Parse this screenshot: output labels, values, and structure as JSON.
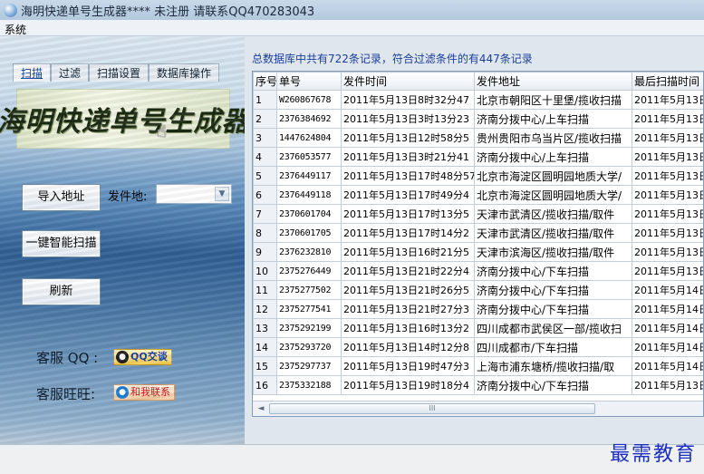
{
  "window": {
    "title": "海明快递单号生成器****  未注册 请联系QQ470283043"
  },
  "menu": {
    "items": [
      "系统"
    ]
  },
  "left": {
    "tabs": [
      "扫描",
      "过滤",
      "扫描设置",
      "数据库操作"
    ],
    "banner_text": "海明快递单号生成器",
    "import_button": "导入地址",
    "sender_label": "发件地:",
    "sender_value": "",
    "smart_scan_button": "一键智能扫描",
    "refresh_button": "刷新",
    "support_qq_label": "客服 QQ :",
    "support_qq_badge": "QQ交谈",
    "support_ww_label": "客服旺旺:",
    "support_ww_badge": "和我联系"
  },
  "status_text": "总数据库中共有722条记录，符合过滤条件的有447条记录",
  "table": {
    "columns": [
      "序号",
      "单号",
      "发件时间",
      "发件地址",
      "最后扫描时间"
    ],
    "rows": [
      [
        "1",
        "W260867678",
        "2011年5月13日8时32分47",
        "北京市朝阳区十里堡/揽收扫描",
        "2011年5月13日"
      ],
      [
        "2",
        "2376384692",
        "2011年5月13日3时13分23",
        "济南分拨中心/上车扫描",
        "2011年5月13日"
      ],
      [
        "3",
        "1447624804",
        "2011年5月13日12时58分5",
        "贵州贵阳市乌当片区/揽收扫描",
        "2011年5月13日"
      ],
      [
        "4",
        "2376053577",
        "2011年5月13日3时21分41",
        "济南分拨中心/上车扫描",
        "2011年5月13日"
      ],
      [
        "5",
        "2376449117",
        "2011年5月13日17时48分57",
        "北京市海淀区圆明园地质大学/",
        "2011年5月13日"
      ],
      [
        "6",
        "2376449118",
        "2011年5月13日17时49分4",
        "北京市海淀区圆明园地质大学/",
        "2011年5月13日"
      ],
      [
        "7",
        "2370601704",
        "2011年5月13日17时13分5",
        "天津市武清区/揽收扫描/取件",
        "2011年5月13日"
      ],
      [
        "8",
        "2370601705",
        "2011年5月13日17时14分2",
        "天津市武清区/揽收扫描/取件",
        "2011年5月13日"
      ],
      [
        "9",
        "2376232810",
        "2011年5月13日16时21分5",
        "天津市滨海区/揽收扫描/取件",
        "2011年5月13日"
      ],
      [
        "10",
        "2375276449",
        "2011年5月13日21时22分4",
        "济南分拨中心/下车扫描",
        "2011年5月13日"
      ],
      [
        "11",
        "2375277502",
        "2011年5月13日21时26分5",
        "济南分拨中心/下车扫描",
        "2011年5月14日"
      ],
      [
        "12",
        "2375277541",
        "2011年5月13日21时27分3",
        "济南分拨中心/下车扫描",
        "2011年5月14日"
      ],
      [
        "13",
        "2375292199",
        "2011年5月13日16时13分2",
        "四川成都市武侯区一部/揽收扫",
        "2011年5月14日"
      ],
      [
        "14",
        "2375293720",
        "2011年5月13日14时12分8",
        "四川成都市/下车扫描",
        "2011年5月14日"
      ],
      [
        "15",
        "2375297737",
        "2011年5月13日19时47分3",
        "上海市浦东塘桥/揽收扫描/取",
        "2011年5月14日"
      ],
      [
        "16",
        "2375332188",
        "2011年5月13日19时18分4",
        "济南分拨中心/下车扫描",
        "2011年5月13日"
      ]
    ]
  },
  "scrollbar": {
    "left_arrow": "◄",
    "thumb_grip": "III"
  },
  "watermark": "最需教育"
}
